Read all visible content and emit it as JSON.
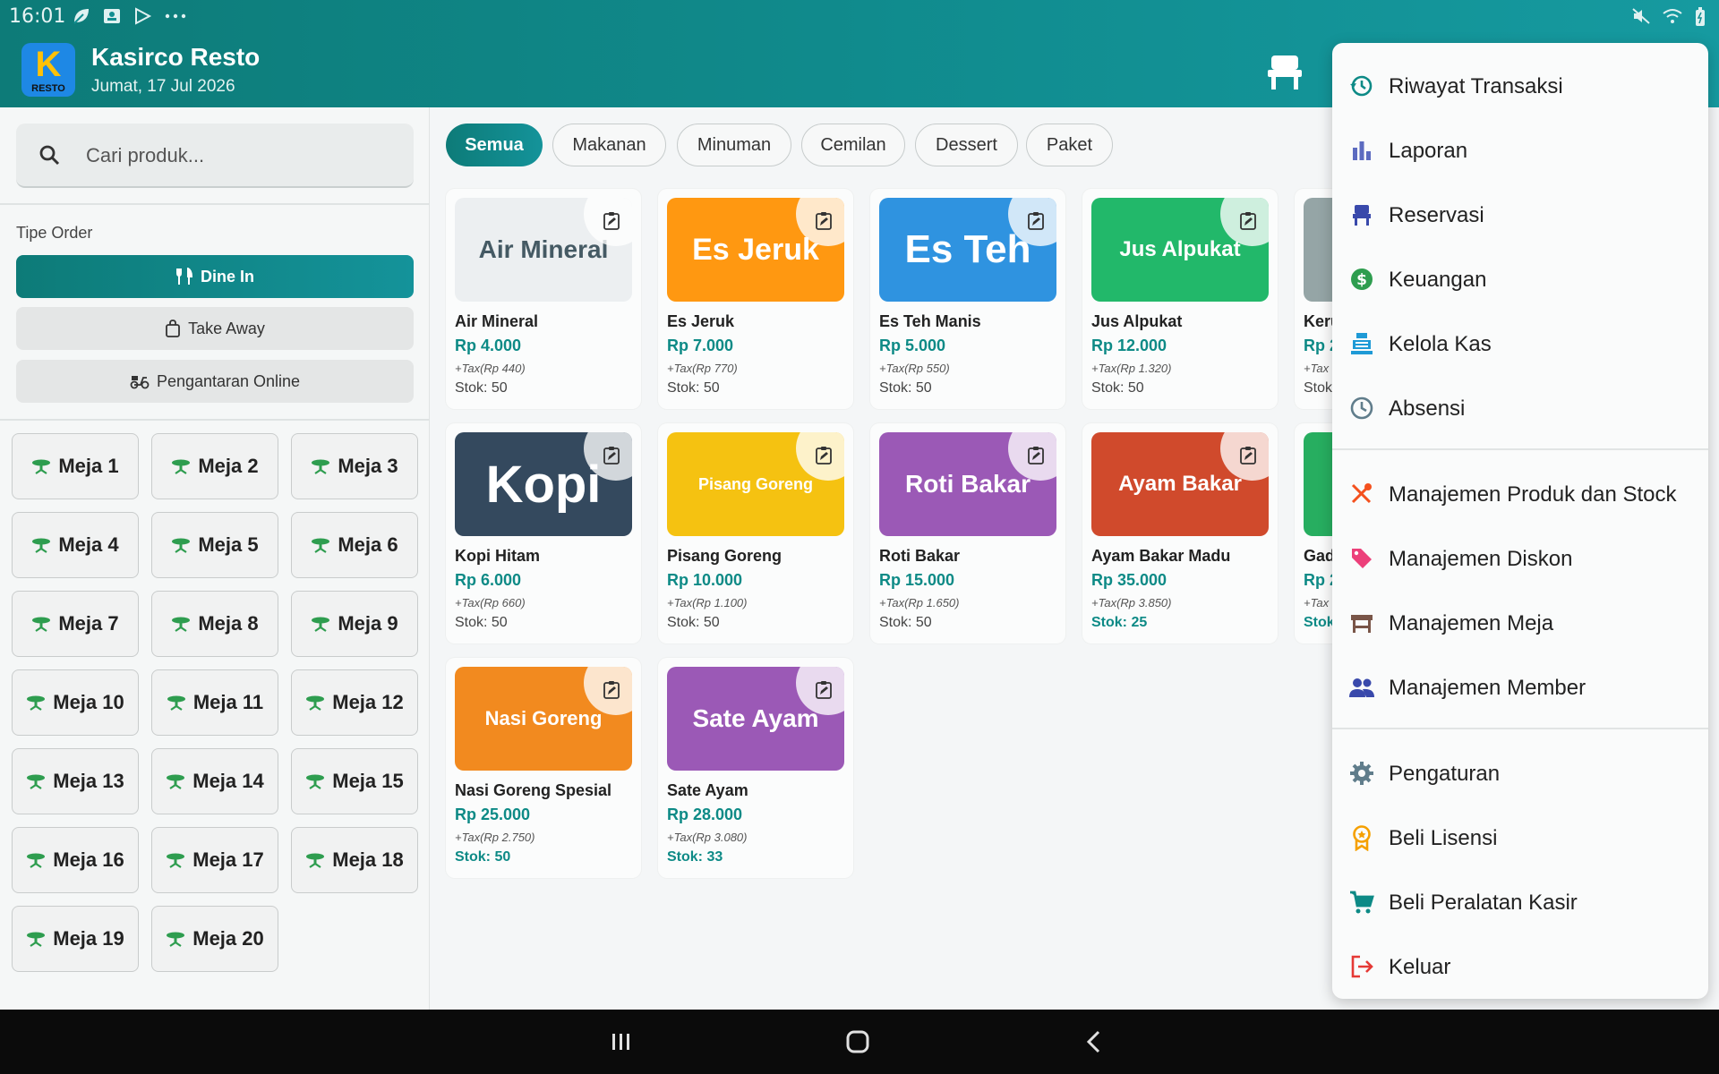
{
  "status_bar": {
    "time": "16:01"
  },
  "header": {
    "app_name": "Kasirco Resto",
    "date": "Jumat, 17 Jul 2026",
    "logo_letter": "K",
    "logo_sub": "RESTO"
  },
  "search": {
    "placeholder": "Cari produk..."
  },
  "order_type": {
    "label": "Tipe Order",
    "options": [
      "Dine In",
      "Take Away",
      "Pengantaran Online"
    ],
    "selected": "Dine In"
  },
  "tables": [
    "Meja 1",
    "Meja 2",
    "Meja 3",
    "Meja 4",
    "Meja 5",
    "Meja 6",
    "Meja 7",
    "Meja 8",
    "Meja 9",
    "Meja 10",
    "Meja 11",
    "Meja 12",
    "Meja 13",
    "Meja 14",
    "Meja 15",
    "Meja 16",
    "Meja 17",
    "Meja 18",
    "Meja 19",
    "Meja 20"
  ],
  "categories": [
    "Semua",
    "Makanan",
    "Minuman",
    "Cemilan",
    "Dessert",
    "Paket"
  ],
  "selected_category": "Semua",
  "products": [
    {
      "name": "Air Mineral",
      "thumb_text": "Air Mineral",
      "price": "Rp 4.000",
      "tax": "+Tax(Rp 440)",
      "stock": "Stok: 50",
      "color": "#eceff1",
      "text_color": "#455a64"
    },
    {
      "name": "Es Jeruk",
      "thumb_text": "Es Jeruk",
      "price": "Rp 7.000",
      "tax": "+Tax(Rp 770)",
      "stock": "Stok: 50",
      "color": "#ff9811",
      "text_color": "#ffffff"
    },
    {
      "name": "Es Teh Manis",
      "thumb_text": "Es Teh",
      "price": "Rp 5.000",
      "tax": "+Tax(Rp 550)",
      "stock": "Stok: 50",
      "color": "#2f93e0",
      "text_color": "#ffffff"
    },
    {
      "name": "Jus Alpukat",
      "thumb_text": "Jus Alpukat",
      "price": "Rp 12.000",
      "tax": "+Tax(Rp 1.320)",
      "stock": "Stok: 50",
      "color": "#22b86a",
      "text_color": "#ffffff"
    },
    {
      "name": "Keru",
      "thumb_text": "",
      "price": "Rp 2",
      "tax": "+Tax",
      "stock": "Stok",
      "color": "#95a5a6",
      "text_color": "#ffffff"
    },
    {
      "name": "Kopi Hitam",
      "thumb_text": "Kopi",
      "price": "Rp 6.000",
      "tax": "+Tax(Rp 660)",
      "stock": "Stok: 50",
      "color": "#34495e",
      "text_color": "#ffffff"
    },
    {
      "name": "Pisang Goreng",
      "thumb_text": "Pisang Goreng",
      "price": "Rp 10.000",
      "tax": "+Tax(Rp 1.100)",
      "stock": "Stok: 50",
      "color": "#f5c211",
      "text_color": "#ffffff"
    },
    {
      "name": "Roti Bakar",
      "thumb_text": "Roti Bakar",
      "price": "Rp 15.000",
      "tax": "+Tax(Rp 1.650)",
      "stock": "Stok: 50",
      "color": "#9b59b6",
      "text_color": "#ffffff"
    },
    {
      "name": "Ayam Bakar Madu",
      "thumb_text": "Ayam Bakar",
      "price": "Rp 35.000",
      "tax": "+Tax(Rp 3.850)",
      "stock": "Stok: 25",
      "color": "#d04a2c",
      "text_color": "#ffffff",
      "low": true
    },
    {
      "name": "Gad",
      "thumb_text": "",
      "price": "Rp 2",
      "tax": "+Tax",
      "stock": "Stok",
      "color": "#27ae60",
      "text_color": "#ffffff",
      "low": true
    },
    {
      "name": "Nasi Goreng Spesial",
      "thumb_text": "Nasi Goreng",
      "price": "Rp 25.000",
      "tax": "+Tax(Rp 2.750)",
      "stock": "Stok: 50",
      "color": "#f28a1f",
      "text_color": "#ffffff",
      "low": true
    },
    {
      "name": "Sate Ayam",
      "thumb_text": "Sate Ayam",
      "price": "Rp 28.000",
      "tax": "+Tax(Rp 3.080)",
      "stock": "Stok: 33",
      "color": "#9b59b6",
      "text_color": "#ffffff",
      "low": true
    }
  ],
  "menu": {
    "items": [
      {
        "label": "Riwayat Transaksi",
        "icon": "history-icon",
        "color": "#0d8a86"
      },
      {
        "label": "Laporan",
        "icon": "bar-chart-icon",
        "color": "#5c6bc0"
      },
      {
        "label": "Reservasi",
        "icon": "chair-icon",
        "color": "#3949ab"
      },
      {
        "label": "Keuangan",
        "icon": "dollar-icon",
        "color": "#2e9d4f"
      },
      {
        "label": "Kelola Kas",
        "icon": "cash-register-icon",
        "color": "#1e9ad6"
      },
      {
        "label": "Absensi",
        "icon": "clock-icon",
        "color": "#607d8b"
      },
      {
        "label": "Manajemen Produk dan Stock",
        "icon": "utensils-icon",
        "color": "#f4511e"
      },
      {
        "label": "Manajemen Diskon",
        "icon": "tag-icon",
        "color": "#ec407a"
      },
      {
        "label": "Manajemen Meja",
        "icon": "table-icon",
        "color": "#795548"
      },
      {
        "label": "Manajemen Member",
        "icon": "people-icon",
        "color": "#3949ab"
      },
      {
        "label": "Pengaturan",
        "icon": "gear-icon",
        "color": "#607d8b"
      },
      {
        "label": "Beli Lisensi",
        "icon": "award-icon",
        "color": "#f5a000"
      },
      {
        "label": "Beli Peralatan Kasir",
        "icon": "cart-icon",
        "color": "#0d8a86"
      },
      {
        "label": "Keluar",
        "icon": "logout-icon",
        "color": "#e53935"
      }
    ]
  }
}
